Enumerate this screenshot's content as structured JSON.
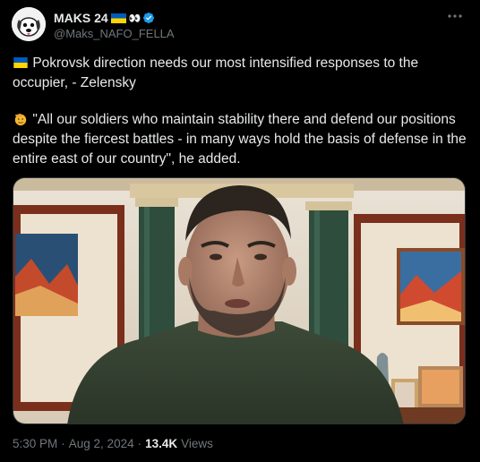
{
  "author": {
    "display_name": "MAKS 24",
    "name_emojis": "👀",
    "handle": "@Maks_NAFO_FELLA",
    "verified": true
  },
  "tweet": {
    "paragraph1": "Pokrovsk direction needs our most intensified responses to the occupier, - Zelensky",
    "paragraph2": "\"All our soldiers who maintain stability there and defend our positions despite the fiercest battles - in many ways hold the basis of defense in the entire east of our country\", he added."
  },
  "meta": {
    "time": "5:30 PM",
    "date": "Aug 2, 2024",
    "views_count": "13.4K",
    "views_label": "Views",
    "separator": "·"
  },
  "colors": {
    "background": "#000000",
    "text": "#e7e9ea",
    "secondary": "#71767b",
    "verified": "#1d9bf0",
    "flag_blue": "#005bbb",
    "flag_yellow": "#ffd500"
  }
}
